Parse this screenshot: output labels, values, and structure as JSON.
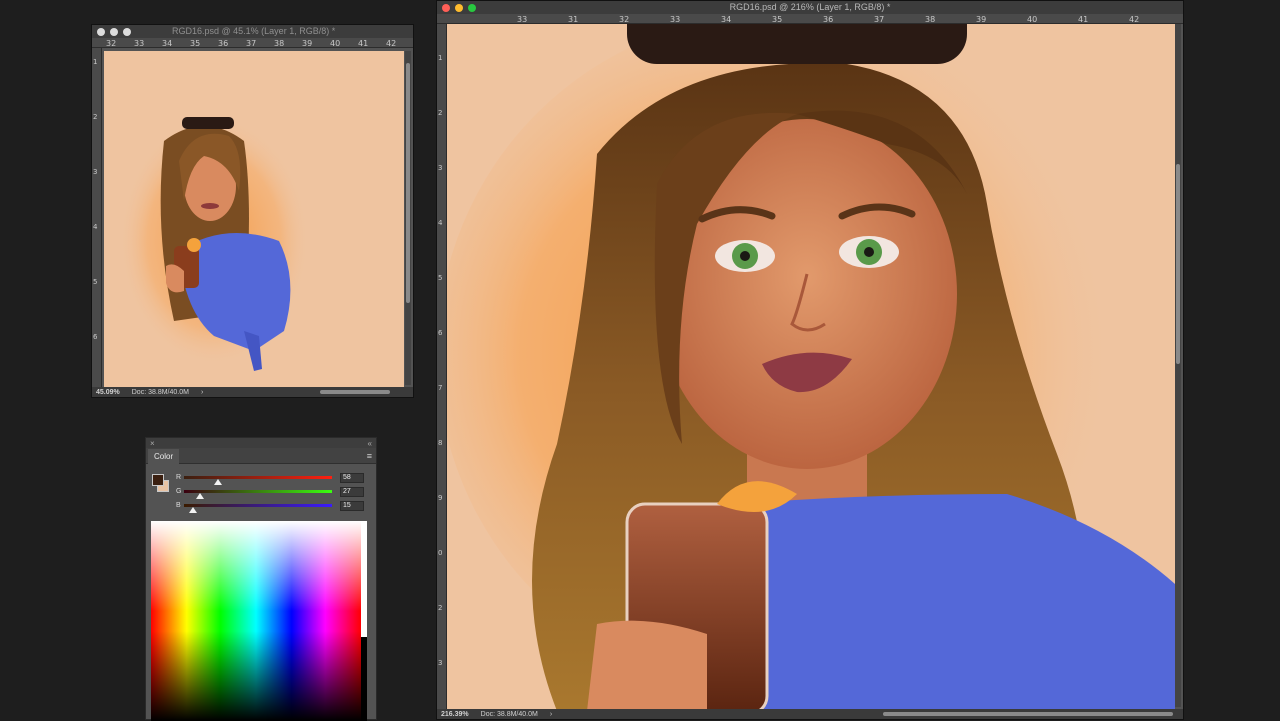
{
  "small_doc": {
    "title": "RGD16.psd @ 45.1% (Layer 1, RGB/8) *",
    "ruler_ticks": [
      "32",
      "33",
      "34",
      "35",
      "36",
      "37",
      "38",
      "39",
      "40",
      "41",
      "42"
    ],
    "ruler_vticks": [
      "1",
      "2",
      "3",
      "4",
      "5",
      "6"
    ],
    "status_zoom": "45.09%",
    "status_doc": "Doc: 38.8M/40.0M",
    "status_arrow": "›"
  },
  "main_doc": {
    "title": "RGD16.psd @ 216% (Layer 1, RGB/8) *",
    "ruler_ticks": [
      "33",
      "31",
      "32",
      "33",
      "34",
      "35",
      "36",
      "37",
      "38",
      "39",
      "40",
      "41",
      "42"
    ],
    "ruler_vticks": [
      "1",
      "2",
      "3",
      "4",
      "5",
      "6",
      "7",
      "8",
      "9",
      "0",
      "2",
      "3"
    ],
    "status_zoom": "216.39%",
    "status_doc": "Doc: 38.8M/40.0M",
    "status_arrow": "›"
  },
  "color_panel": {
    "tab_label": "Color",
    "menu_icon": "≡",
    "collapse_icon": "«",
    "close_icon": "×",
    "foreground_color": "#3a1f10",
    "background_color": "#e8c3a4",
    "sliders": [
      {
        "label": "R",
        "value": "58",
        "fraction": 0.227,
        "track": "linear-gradient(90deg,#3a1f10,#ff1f10)"
      },
      {
        "label": "G",
        "value": "27",
        "fraction": 0.106,
        "track": "linear-gradient(90deg,#3a0010,#3aff10)"
      },
      {
        "label": "B",
        "value": "15",
        "fraction": 0.059,
        "track": "linear-gradient(90deg,#3a1b00,#3a1bff)"
      }
    ]
  },
  "traffic_lights": {
    "close": "#ff5f57",
    "minimize": "#febc2e",
    "zoom": "#28c840"
  },
  "canvas_colors": {
    "background": "#efc4a0",
    "shirt": "#5468d8",
    "hair": "#7a4d22",
    "glow": "#f4a455"
  }
}
